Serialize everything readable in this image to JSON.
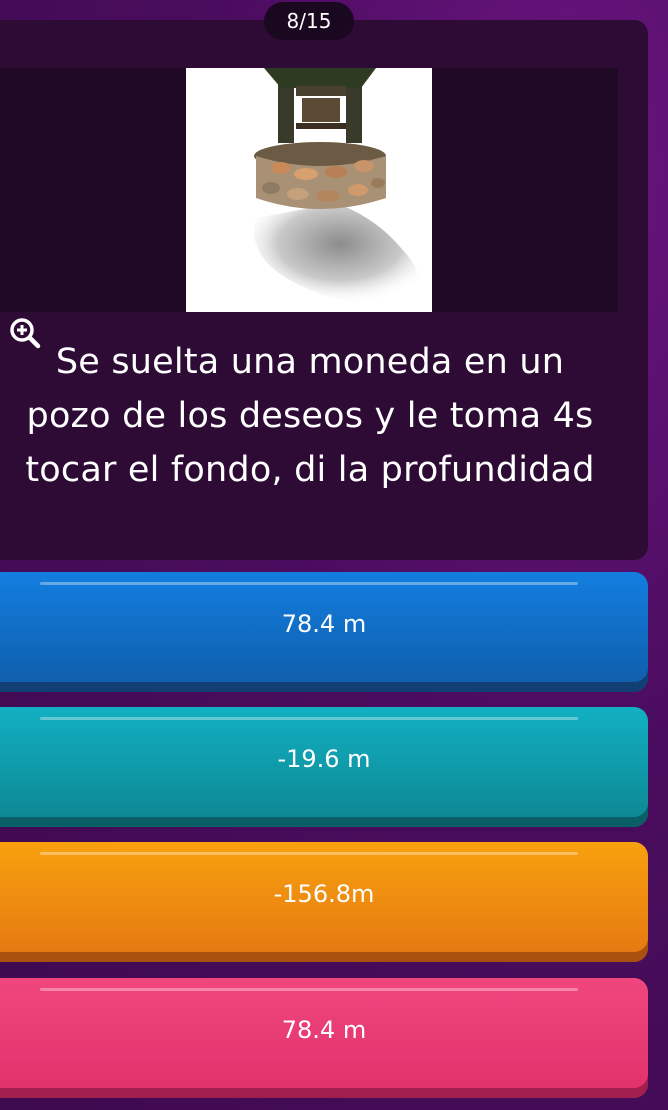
{
  "progress": {
    "counter": "8/15"
  },
  "question": {
    "text": "Se suelta una moneda en un pozo de los deseos y le toma 4s tocar el fondo, di la profundidad",
    "image_icon": "wishing-well-image",
    "zoom_icon": "zoom-in-icon"
  },
  "answers": [
    {
      "label": "78.4 m",
      "color": "#137ee0"
    },
    {
      "label": "-19.6 m",
      "color": "#12b0c3"
    },
    {
      "label": "-156.8m",
      "color": "#f8a10e"
    },
    {
      "label": "78.4 m",
      "color": "#f0467e"
    }
  ],
  "colors": {
    "background": "#4a0c5e",
    "card": "#2d0b35"
  }
}
